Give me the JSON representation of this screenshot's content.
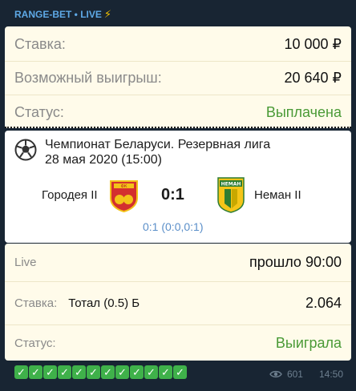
{
  "header": {
    "channel": "RANGE-BET • LIVE",
    "bolt_icon": "lightning-icon"
  },
  "summary": {
    "stake_label": "Ставка:",
    "stake_value": "10 000 ₽",
    "win_label": "Возможный выигрыш:",
    "win_value": "20 640 ₽",
    "status_label": "Статус:",
    "status_value": "Выплачена"
  },
  "match": {
    "league_line1": "Чемпионат Беларуси. Резервная лига",
    "league_line2": "28 мая 2020 (15:00)",
    "home": "Городея II",
    "away": "Неман II",
    "score": "0:1",
    "score_detail": "0:1 (0:0,0:1)"
  },
  "bet": {
    "live_label": "Live",
    "live_value": "прошло 90:00",
    "stake_label": "Ставка:",
    "bet_type": "Тотал (0.5) Б",
    "odds": "2.064",
    "status_label": "Статус:",
    "status_value": "Выиграла"
  },
  "footer": {
    "checks": [
      "✓",
      "✓",
      "✓",
      "✓",
      "✓",
      "✓",
      "✓",
      "✓",
      "✓",
      "✓",
      "✓",
      "✓"
    ],
    "views": "601",
    "time": "14:50"
  },
  "colors": {
    "accent": "#5ea9e6",
    "green": "#4a9a36",
    "card": "#fffbea"
  }
}
